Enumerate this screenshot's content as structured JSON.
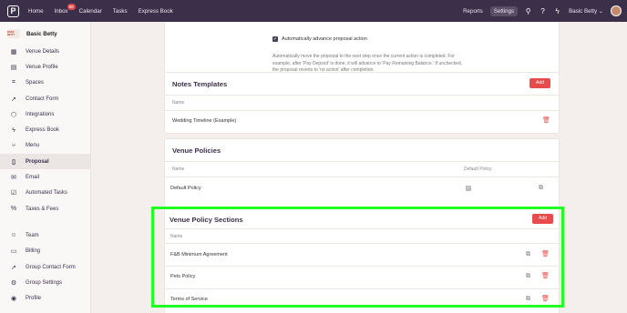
{
  "topbar": {
    "logo": "P",
    "nav": [
      "Home",
      "Inbox",
      "Calendar",
      "Tasks",
      "Express Book"
    ],
    "inbox_badge": "99",
    "right": [
      "Reports",
      "Settings"
    ],
    "user": "Basic Betty"
  },
  "sidebar": {
    "business_name": "Basic Betty",
    "logo_text": "BASIC BETTY",
    "items": [
      {
        "label": "Venue Details",
        "icon": "building-icon"
      },
      {
        "label": "Venue Profile",
        "icon": "profile-card-icon"
      },
      {
        "label": "Spaces",
        "icon": "spaces-icon"
      },
      {
        "label": "Contact Form",
        "icon": "cursor-icon"
      },
      {
        "label": "Integrations",
        "icon": "cube-icon"
      },
      {
        "label": "Express Book",
        "icon": "lightning-icon"
      },
      {
        "label": "Menu",
        "icon": "utensils-icon"
      },
      {
        "label": "Proposal",
        "icon": "clipboard-icon"
      },
      {
        "label": "Email",
        "icon": "mail-icon"
      },
      {
        "label": "Automated Tasks",
        "icon": "checkbox-icon"
      },
      {
        "label": "Taxes & Fees",
        "icon": "percent-icon"
      }
    ],
    "items2": [
      {
        "label": "Team",
        "icon": "team-icon"
      },
      {
        "label": "Billing",
        "icon": "card-icon"
      },
      {
        "label": "Group Contact Form",
        "icon": "cursor-icon"
      },
      {
        "label": "Group Settings",
        "icon": "gear-icon"
      },
      {
        "label": "Profile",
        "icon": "user-icon"
      }
    ],
    "collapse": "«"
  },
  "proposal_action": {
    "checkbox_label": "Automatically advance proposal action",
    "description_lines": [
      "Automatically move the proposal to the next step once the current action is completed. For",
      "example, after 'Pay Deposit' is done, it will advance to 'Pay Remaining Balance.' If unchecked,",
      "the proposal reverts to 'no action' after completion."
    ]
  },
  "notes_templates": {
    "title": "Notes Templates",
    "add": "Add",
    "col_name": "Name",
    "rows": [
      "Wedding Timeline (Example)"
    ]
  },
  "venue_policies": {
    "title": "Venue Policies",
    "col_name": "Name",
    "col_default": "Default Policy",
    "rows": [
      "Default Policy"
    ]
  },
  "venue_policy_sections": {
    "title": "Venue Policy Sections",
    "add": "Add",
    "col_name": "Name",
    "rows": [
      "F&B Minimum Agreement",
      "Pets Policy",
      "Terms of Service"
    ]
  },
  "colors": {
    "accent": "#e84b4b",
    "topbar": "#3c2f4a",
    "highlight": "#22ff22"
  }
}
